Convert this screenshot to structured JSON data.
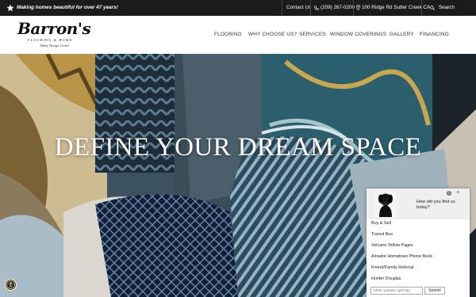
{
  "topbar": {
    "tagline": "Making homes beautiful for over 47 years!",
    "contact": "Contact Us",
    "phone": "(209) 267-0200",
    "address": "100 Ridge Rd Sutter Creek CA",
    "search": "Search"
  },
  "logo": {
    "name": "Barron's",
    "sub": "FLOORING & HOME",
    "sub2": "Abbey Design Center"
  },
  "nav": [
    "FLOORING",
    "WHY CHOOSE US?",
    "SERVICES",
    "WINDOW COVERINGS",
    "GALLERY",
    "FINANCING"
  ],
  "hero": {
    "title": "DEFINE YOUR DREAM SPACE"
  },
  "widget": {
    "question": "How did you find us today?",
    "options": [
      "Buy & Sell",
      "Transit Bus",
      "Volcano Yellow Pages",
      "Amador Hometown Phone Book",
      "Friend/Family Referral",
      "Hunter Douglas"
    ],
    "other_placeholder": "Other (please specify)",
    "submit": "Submit",
    "close": "×",
    "info": "i"
  },
  "colors": {
    "topbar_bg": "#1b1b1b",
    "hero_title": "#ffffff",
    "accessibility_bg": "#1f2e5a",
    "accessibility_icon": "#f1c21b"
  },
  "icons": [
    "star-icon",
    "phone-icon",
    "location-icon",
    "search-icon",
    "accessibility-icon",
    "info-icon",
    "close-icon",
    "dog-photo"
  ]
}
